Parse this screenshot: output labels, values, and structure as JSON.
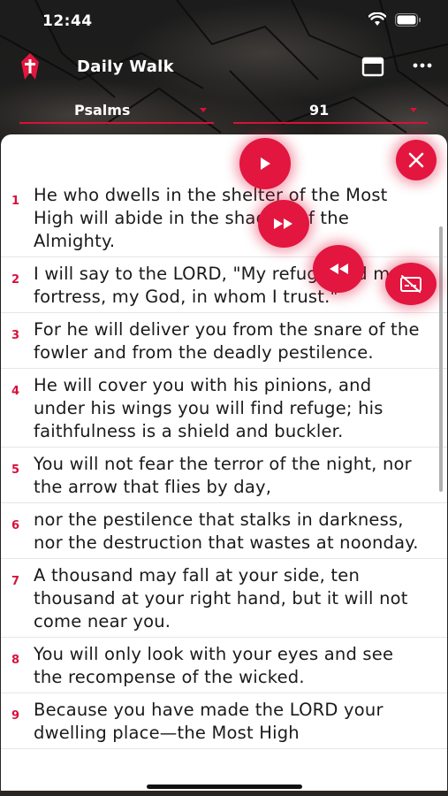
{
  "status_bar": {
    "time": "12:44"
  },
  "header": {
    "title": "Daily Walk",
    "icons": [
      "app-logo-icon",
      "calendar-icon",
      "more-icon"
    ]
  },
  "selectors": {
    "book": "Psalms",
    "chapter": "91"
  },
  "colors": {
    "accent": "#e2163f",
    "verse_number": "#d8113a",
    "panel_bg": "#ffffff",
    "text": "#1a1a1a"
  },
  "audio_controls": {
    "icons": [
      "play-icon",
      "close-icon",
      "fast-forward-icon",
      "rewind-icon",
      "captions-off-icon"
    ]
  },
  "verses": [
    {
      "number": "1",
      "text": "He who dwells in the shelter of the Most High will abide in the shadow of the Almighty."
    },
    {
      "number": "2",
      "text": "I will say to the LORD, \"My refuge and my fortress, my God, in whom I trust.\""
    },
    {
      "number": "3",
      "text": "For he will deliver you from the snare of the fowler and from the deadly pestilence."
    },
    {
      "number": "4",
      "text": "He will cover you with his pinions, and under his wings you will find refuge; his faithfulness is a shield and buckler."
    },
    {
      "number": "5",
      "text": "You will not fear the terror of the night, nor the arrow that flies by day,"
    },
    {
      "number": "6",
      "text": "nor the pestilence that stalks in darkness, nor the destruction that wastes at noonday."
    },
    {
      "number": "7",
      "text": "A thousand may fall at your side, ten thousand at your right hand, but it will not come near you."
    },
    {
      "number": "8",
      "text": "You will only look with your eyes and see the recompense of the wicked."
    },
    {
      "number": "9",
      "text": "Because you have made the LORD your dwelling place—the Most High"
    }
  ]
}
